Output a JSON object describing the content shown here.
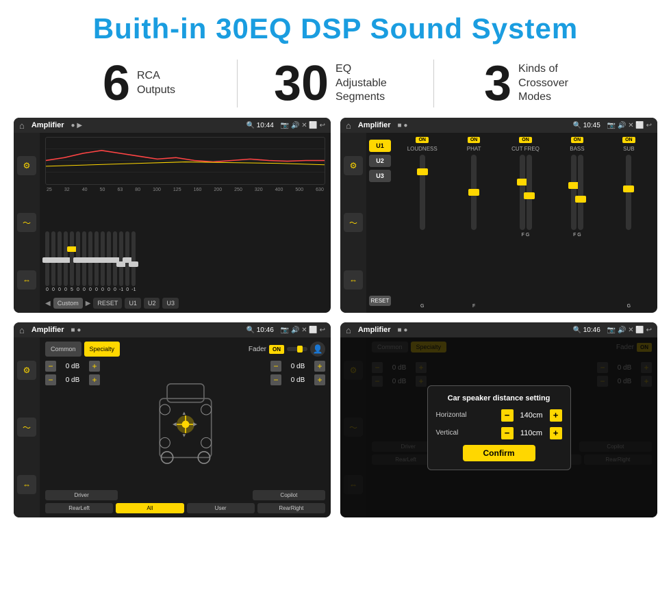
{
  "title": "Buith-in 30EQ DSP Sound System",
  "stats": [
    {
      "number": "6",
      "label": "RCA\nOutputs"
    },
    {
      "number": "30",
      "label": "EQ Adjustable\nSegments"
    },
    {
      "number": "3",
      "label": "Kinds of\nCrossover Modes"
    }
  ],
  "screens": [
    {
      "id": "eq-screen",
      "title": "Amplifier",
      "time": "10:44",
      "description": "30-band EQ equalizer"
    },
    {
      "id": "crossover-screen",
      "title": "Amplifier",
      "time": "10:45",
      "description": "Crossover control"
    },
    {
      "id": "fader-screen",
      "title": "Amplifier",
      "time": "10:46",
      "description": "Fader/Common control"
    },
    {
      "id": "distance-screen",
      "title": "Amplifier",
      "time": "10:46",
      "description": "Speaker distance setting",
      "dialog": {
        "title": "Car speaker distance setting",
        "horizontal_label": "Horizontal",
        "horizontal_value": "140cm",
        "vertical_label": "Vertical",
        "vertical_value": "110cm",
        "confirm_label": "Confirm"
      }
    }
  ],
  "eq": {
    "frequencies": [
      "25",
      "32",
      "40",
      "50",
      "63",
      "80",
      "100",
      "125",
      "160",
      "200",
      "250",
      "320",
      "400",
      "500",
      "630"
    ],
    "values": [
      "0",
      "0",
      "0",
      "0",
      "5",
      "0",
      "0",
      "0",
      "0",
      "0",
      "0",
      "0",
      "-1",
      "0",
      "-1"
    ],
    "bottom_buttons": [
      "Custom",
      "RESET",
      "U1",
      "U2",
      "U3"
    ]
  },
  "crossover": {
    "presets": [
      "U1",
      "U2",
      "U3"
    ],
    "controls": [
      "LOUDNESS",
      "PHAT",
      "CUT FREQ",
      "BASS",
      "SUB"
    ],
    "on_label": "ON"
  },
  "fader": {
    "tabs": [
      "Common",
      "Specialty"
    ],
    "active_tab": "Specialty",
    "fader_label": "Fader",
    "on_label": "ON",
    "buttons": [
      "Driver",
      "RearLeft",
      "All",
      "User",
      "RearRight",
      "Copilot"
    ],
    "db_values": [
      "0 dB",
      "0 dB",
      "0 dB",
      "0 dB"
    ]
  }
}
